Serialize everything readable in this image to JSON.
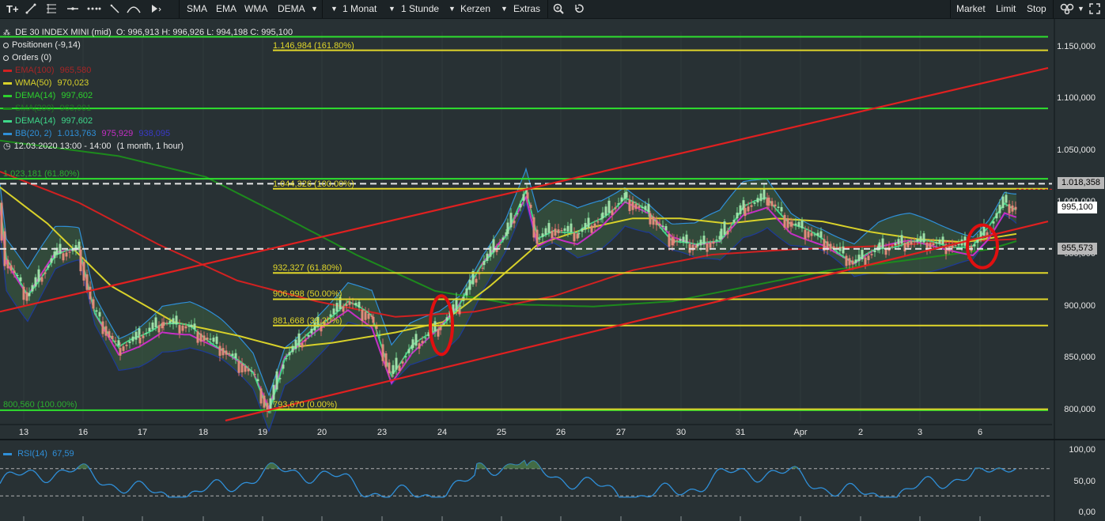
{
  "toolbar": {
    "left_tools": [
      "T+",
      "line-tool",
      "fib-tool",
      "hline-tool",
      "dotted-line-tool",
      "pen-tool",
      "curve-tool",
      "arrow-tool"
    ],
    "indicators": [
      "SMA",
      "EMA",
      "WMA",
      "DEMA"
    ],
    "period": "1 Monat",
    "interval": "1 Stunde",
    "chart_type": "Kerzen",
    "extras": "Extras",
    "orders": [
      "Market",
      "Limit",
      "Stop"
    ]
  },
  "header": {
    "instrument": "DE 30 INDEX MINI (mid)",
    "ohlc": "O: 996,913  H: 996,926  L: 994,198  C: 995,100"
  },
  "legend": [
    {
      "label": "Positionen (-9,14)",
      "value": "",
      "value2": "",
      "value3": "",
      "color": "#e6e6e6"
    },
    {
      "label": "Orders (0)",
      "value": "",
      "value2": "",
      "value3": "",
      "color": "#e6e6e6"
    },
    {
      "label": "EMA(100)",
      "value": "965,580",
      "value2": "",
      "value3": "",
      "color": "#d12121"
    },
    {
      "label": "WMA(50)",
      "value": "970,023",
      "value2": "",
      "value3": "",
      "color": "#d8d12a"
    },
    {
      "label": "DEMA(14)",
      "value": "997,602",
      "value2": "",
      "value3": "",
      "color": "#2dd12d"
    },
    {
      "label": "SMA(200)",
      "value": "963,001",
      "value2": "",
      "value3": "",
      "color": "#1d8a1d"
    },
    {
      "label": "DEMA(14)",
      "value": "997,602",
      "value2": "",
      "value3": "",
      "color": "#3ed88a"
    },
    {
      "label": "BB(20, 2)",
      "value": "1.013,763",
      "value2": "975,929",
      "value3": "938,095",
      "color": "#2f8fd8"
    },
    {
      "label": "12.03.2020 13:00 - 14:00",
      "value": "(1 month, 1 hour)",
      "value2": "",
      "value3": "",
      "color": "#e6e6e6"
    }
  ],
  "fib_labels": [
    {
      "text": "1.146,984 (161.80%)",
      "price": 1146984
    },
    {
      "text": "1.044,326 (100.00%)",
      "price": 1015500
    },
    {
      "text": "932,327 (61.80%)",
      "price": 932327
    },
    {
      "text": "906,998 (50.00%)",
      "price": 906998
    },
    {
      "text": "881,668 (38.20%)",
      "price": 881668
    },
    {
      "text": "793,670 (0.00%)",
      "price": 800000
    },
    {
      "text": "1.023,181 (61.80%)",
      "price": 1023181
    },
    {
      "text": "800,560 (100.00%)",
      "price": 800560
    }
  ],
  "price_axis": [
    "1.150,000",
    "1.100,000",
    "1.050,000",
    "1.000,000",
    "950,000",
    "900,000",
    "850,000",
    "800,000"
  ],
  "price_markers": [
    "1.018,358",
    "995,100",
    "955,573"
  ],
  "time_axis": [
    "13",
    "16",
    "17",
    "18",
    "19",
    "20",
    "23",
    "24",
    "25",
    "26",
    "27",
    "30",
    "31",
    "Apr",
    "2",
    "3",
    "6"
  ],
  "rsi": {
    "label": "RSI(14)",
    "value": "67,59",
    "axis": [
      "100,00",
      "50,00",
      "0,00"
    ]
  },
  "chart_data": {
    "type": "line",
    "title": "DE 30 INDEX MINI (mid)",
    "x_start": "12.03.2020 13:00",
    "ylim": [
      790000,
      1165000
    ],
    "series": [
      {
        "name": "DE 30 INDEX MINI (mid)",
        "points": [
          [
            0,
            1000000
          ],
          [
            8,
            945000
          ],
          [
            35,
            910000
          ],
          [
            70,
            950000
          ],
          [
            100,
            955000
          ],
          [
            120,
            895000
          ],
          [
            150,
            860000
          ],
          [
            175,
            870000
          ],
          [
            205,
            885000
          ],
          [
            240,
            880000
          ],
          [
            280,
            860000
          ],
          [
            320,
            835000
          ],
          [
            340,
            800000
          ],
          [
            360,
            850000
          ],
          [
            400,
            880000
          ],
          [
            440,
            905000
          ],
          [
            470,
            890000
          ],
          [
            495,
            835000
          ],
          [
            520,
            860000
          ],
          [
            555,
            880000
          ],
          [
            580,
            900000
          ],
          [
            610,
            940000
          ],
          [
            640,
            970000
          ],
          [
            665,
            1010000
          ],
          [
            680,
            965000
          ],
          [
            700,
            975000
          ],
          [
            730,
            970000
          ],
          [
            760,
            985000
          ],
          [
            790,
            1005000
          ],
          [
            820,
            990000
          ],
          [
            850,
            965000
          ],
          [
            880,
            958000
          ],
          [
            910,
            965000
          ],
          [
            940,
            995000
          ],
          [
            970,
            1005000
          ],
          [
            1000,
            980000
          ],
          [
            1040,
            965000
          ],
          [
            1080,
            942000
          ],
          [
            1110,
            955000
          ],
          [
            1150,
            963000
          ],
          [
            1190,
            960000
          ],
          [
            1230,
            958000
          ],
          [
            1250,
            975000
          ],
          [
            1270,
            1000000
          ],
          [
            1285,
            995000
          ]
        ]
      },
      {
        "name": "EMA(100)",
        "points": [
          [
            0,
            1030000
          ],
          [
            100,
            1000000
          ],
          [
            200,
            960000
          ],
          [
            300,
            925000
          ],
          [
            400,
            905000
          ],
          [
            500,
            890000
          ],
          [
            600,
            895000
          ],
          [
            700,
            910000
          ],
          [
            800,
            935000
          ],
          [
            900,
            950000
          ],
          [
            1000,
            955000
          ],
          [
            1100,
            958000
          ],
          [
            1200,
            962000
          ],
          [
            1285,
            965000
          ]
        ]
      },
      {
        "name": "WMA(50)",
        "points": [
          [
            0,
            1015000
          ],
          [
            60,
            980000
          ],
          [
            140,
            920000
          ],
          [
            220,
            885000
          ],
          [
            300,
            872000
          ],
          [
            360,
            860000
          ],
          [
            420,
            865000
          ],
          [
            500,
            875000
          ],
          [
            560,
            885000
          ],
          [
            620,
            920000
          ],
          [
            680,
            960000
          ],
          [
            740,
            975000
          ],
          [
            800,
            985000
          ],
          [
            860,
            985000
          ],
          [
            920,
            980000
          ],
          [
            980,
            985000
          ],
          [
            1040,
            982000
          ],
          [
            1100,
            972000
          ],
          [
            1160,
            965000
          ],
          [
            1220,
            962000
          ],
          [
            1285,
            970000
          ]
        ]
      },
      {
        "name": "SMA(200)",
        "points": [
          [
            0,
            1060000
          ],
          [
            150,
            1045000
          ],
          [
            260,
            1025000
          ],
          [
            350,
            990000
          ],
          [
            450,
            950000
          ],
          [
            550,
            915000
          ],
          [
            650,
            902000
          ],
          [
            750,
            900000
          ],
          [
            850,
            905000
          ],
          [
            950,
            920000
          ],
          [
            1050,
            935000
          ],
          [
            1150,
            945000
          ],
          [
            1250,
            955000
          ],
          [
            1285,
            963000
          ]
        ]
      },
      {
        "name": "BB(20, 2)",
        "points": [
          [
            0,
            1013763
          ],
          [
            1285,
            1013763
          ]
        ]
      }
    ],
    "trendlines": [
      {
        "name": "channel-upper",
        "from": [
          0,
          895000
        ],
        "to": [
          1325,
          1130000
        ]
      },
      {
        "name": "channel-lower",
        "from": [
          285,
          790000
        ],
        "to": [
          1325,
          982000
        ]
      }
    ],
    "horizontal_lines": [
      {
        "name": "green-top",
        "price": 1160000
      },
      {
        "name": "fib-161",
        "price": 1146984
      },
      {
        "name": "green-1",
        "price": 1091000
      },
      {
        "name": "green-2",
        "price": 1023181
      },
      {
        "name": "fib-100",
        "price": 1013500
      },
      {
        "name": "dashed-1018",
        "price": 1018358
      },
      {
        "name": "dashed-955",
        "price": 955573
      },
      {
        "name": "fib-618",
        "price": 932327
      },
      {
        "name": "fib-50",
        "price": 906998
      },
      {
        "name": "fib-382",
        "price": 881668
      },
      {
        "name": "fib-0",
        "price": 800000
      }
    ],
    "annotations": [
      {
        "name": "circle-24",
        "x": 558,
        "price": 880000
      },
      {
        "name": "circle-6",
        "x": 1242,
        "price": 960000
      }
    ]
  }
}
